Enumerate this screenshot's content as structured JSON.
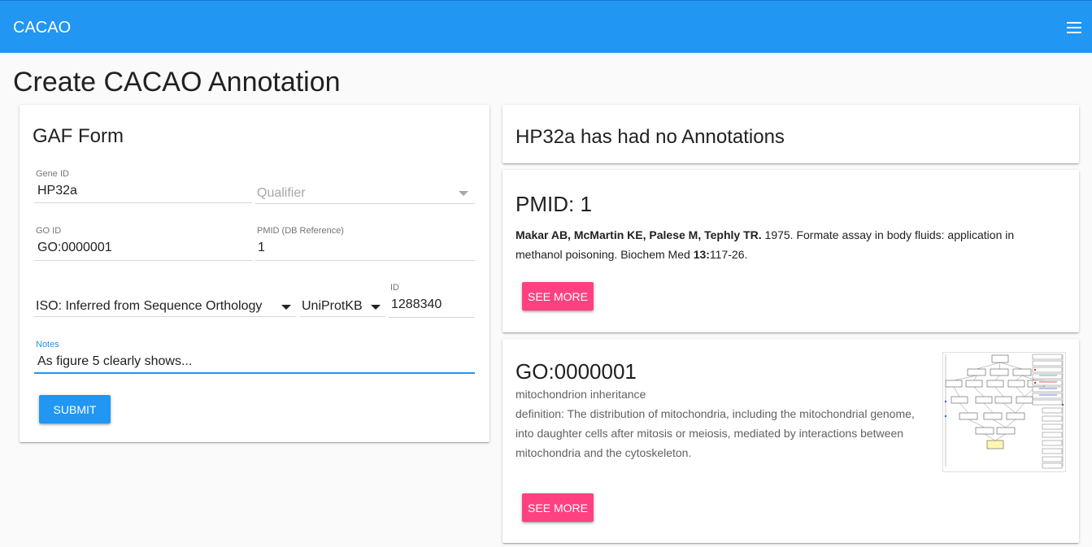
{
  "app": {
    "title": "CACAO"
  },
  "page": {
    "title": "Create CACAO Annotation"
  },
  "form": {
    "title": "GAF Form",
    "gene_id": {
      "label": "Gene ID",
      "value": "HP32a"
    },
    "qualifier": {
      "placeholder": "Qualifier"
    },
    "go_id": {
      "label": "GO ID",
      "value": "GO:0000001"
    },
    "pmid": {
      "label": "PMID (DB Reference)",
      "value": "1"
    },
    "evidence": {
      "value": "ISO: Inferred from Sequence Orthology"
    },
    "db": {
      "value": "UniProtKB"
    },
    "with_id": {
      "label": "ID",
      "value": "1288340"
    },
    "notes": {
      "label": "Notes",
      "value": "As figure 5 clearly shows..."
    },
    "submit_label": "Submit"
  },
  "annotations": {
    "heading": "HP32a has had no Annotations"
  },
  "pubmed": {
    "title": "PMID: 1",
    "authors": "Makar AB, McMartin KE, Palese M, Tephly TR.",
    "citation_text": " 1975. Formate assay in body fluids: application in methanol poisoning. Biochem Med ",
    "volume": "13:",
    "pages": "117-26.",
    "see_more": "See More"
  },
  "go_term": {
    "id": "GO:0000001",
    "name": "mitochondrion inheritance",
    "definition": "definition: The distribution of mitochondria, including the mitochondrial genome, into daughter cells after mitosis or meiosis, mediated by interactions between mitochondria and the cytoskeleton.",
    "see_more": "See More"
  },
  "colors": {
    "primary": "#2196f3",
    "accent": "#ff4081"
  },
  "icons": {
    "menu": "menu-icon",
    "dropdown": "chevron-down-icon",
    "graph": "go-graph-image"
  }
}
